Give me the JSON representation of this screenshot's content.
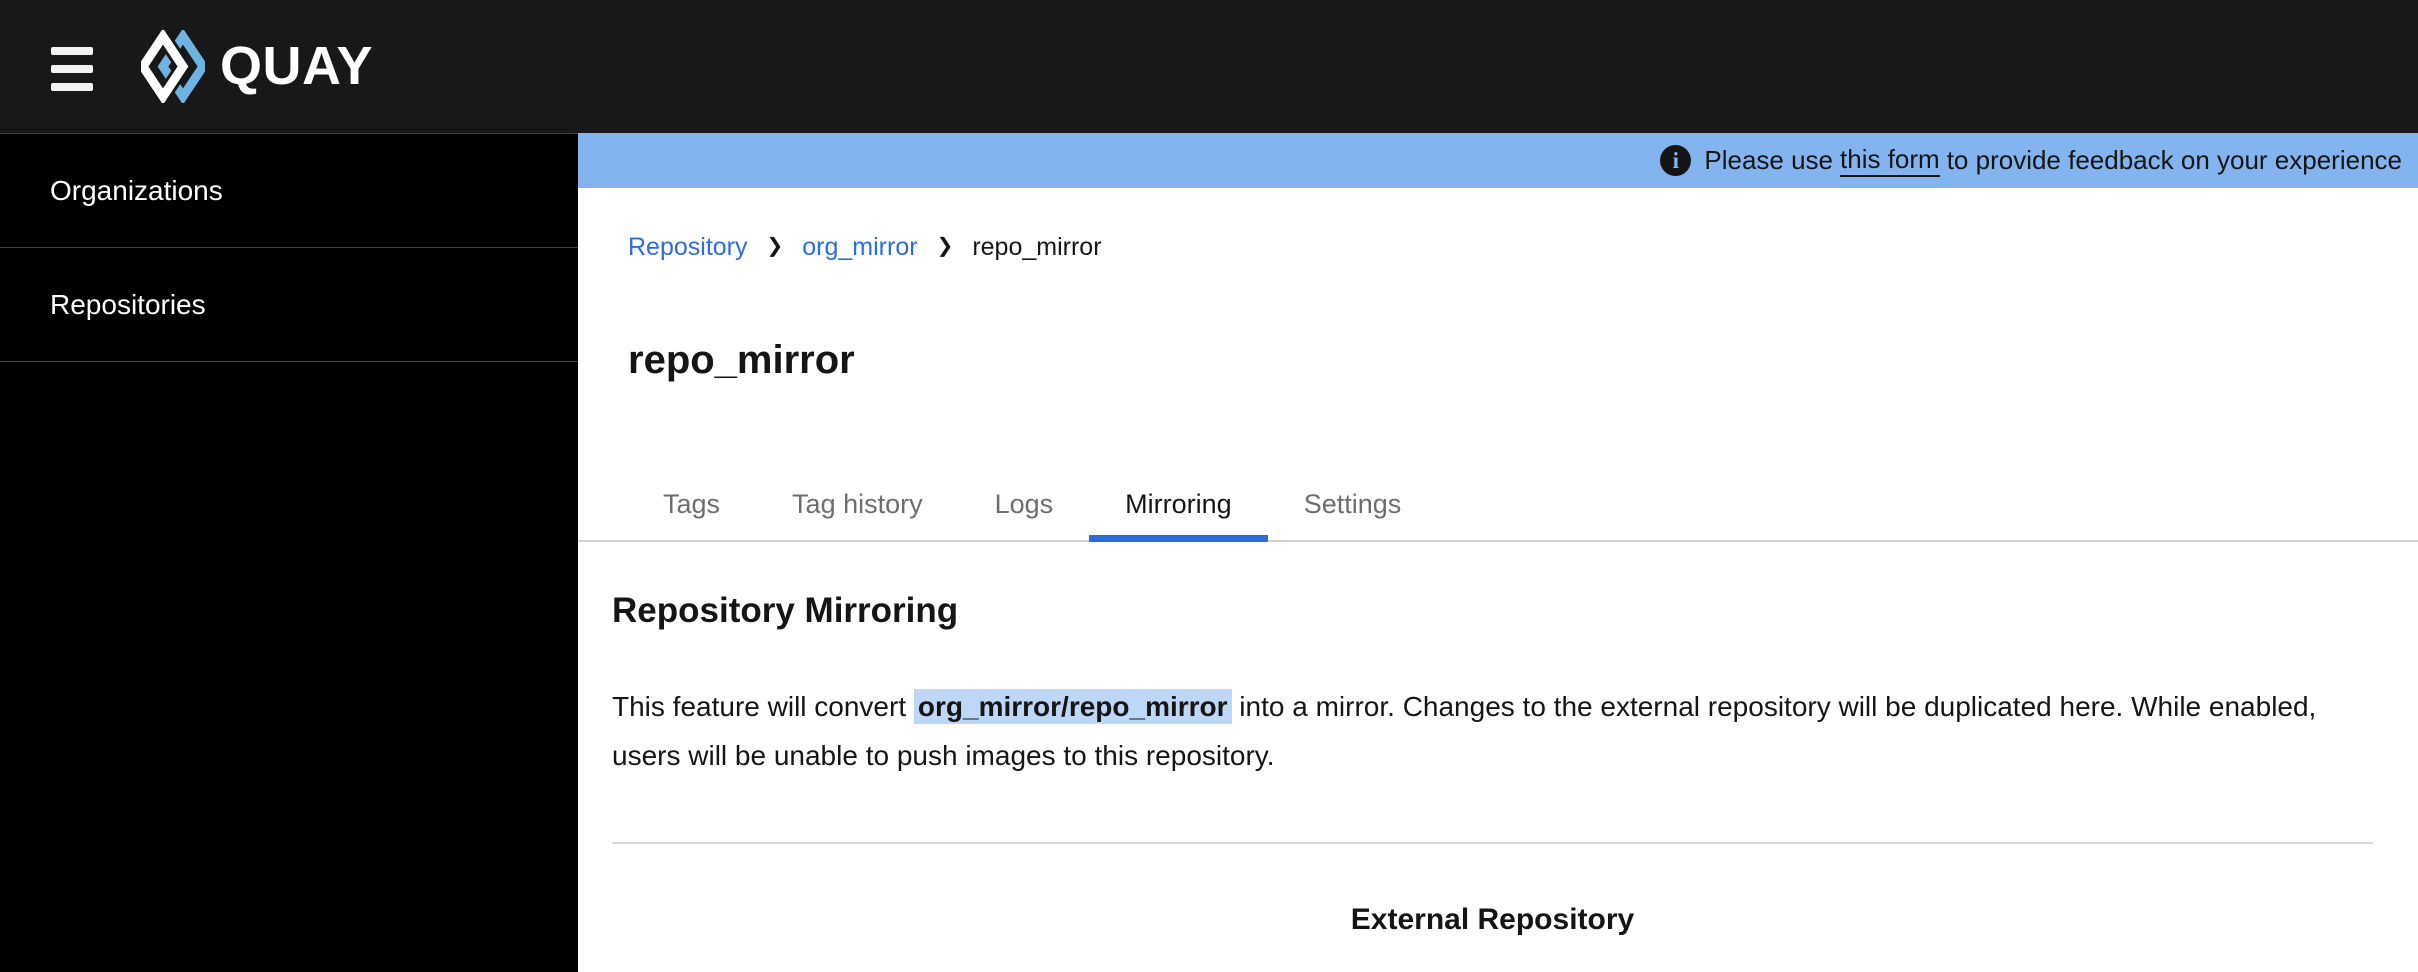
{
  "colors": {
    "header_bg": "#181818",
    "sidebar_bg": "#000000",
    "banner_bg": "#83b4ef",
    "link_blue": "#2b6de0",
    "active_tab_underline": "#2b6bd8",
    "highlight_bg": "#bed7f7",
    "text_dark": "#151515",
    "tab_inactive_gray": "#6a6e73",
    "divider_gray": "#d2d2d2",
    "logo_blue": "#6fb3e0"
  },
  "header": {
    "logo_text": "QUAY"
  },
  "sidebar": {
    "items": [
      {
        "label": "Organizations"
      },
      {
        "label": "Repositories"
      }
    ]
  },
  "banner": {
    "text_prefix": "Please use ",
    "link_label": "this form",
    "text_suffix": " to provide feedback on your experience"
  },
  "breadcrumb": {
    "items": [
      {
        "label": "Repository"
      },
      {
        "label": "org_mirror"
      },
      {
        "label": "repo_mirror"
      }
    ]
  },
  "page": {
    "title": "repo_mirror"
  },
  "tabs": [
    {
      "label": "Tags",
      "active": false
    },
    {
      "label": "Tag history",
      "active": false
    },
    {
      "label": "Logs",
      "active": false
    },
    {
      "label": "Mirroring",
      "active": true
    },
    {
      "label": "Settings",
      "active": false
    }
  ],
  "mirroring": {
    "heading": "Repository Mirroring",
    "desc_before": "This feature will convert ",
    "repo_path": "org_mirror/repo_mirror",
    "desc_after": " into a mirror. Changes to the external repository will be duplicated here. While enabled, users will be unable to push images to this repository.",
    "external_heading": "External Repository"
  },
  "icons": {
    "info": "i",
    "breadcrumb_separator": "❯"
  }
}
